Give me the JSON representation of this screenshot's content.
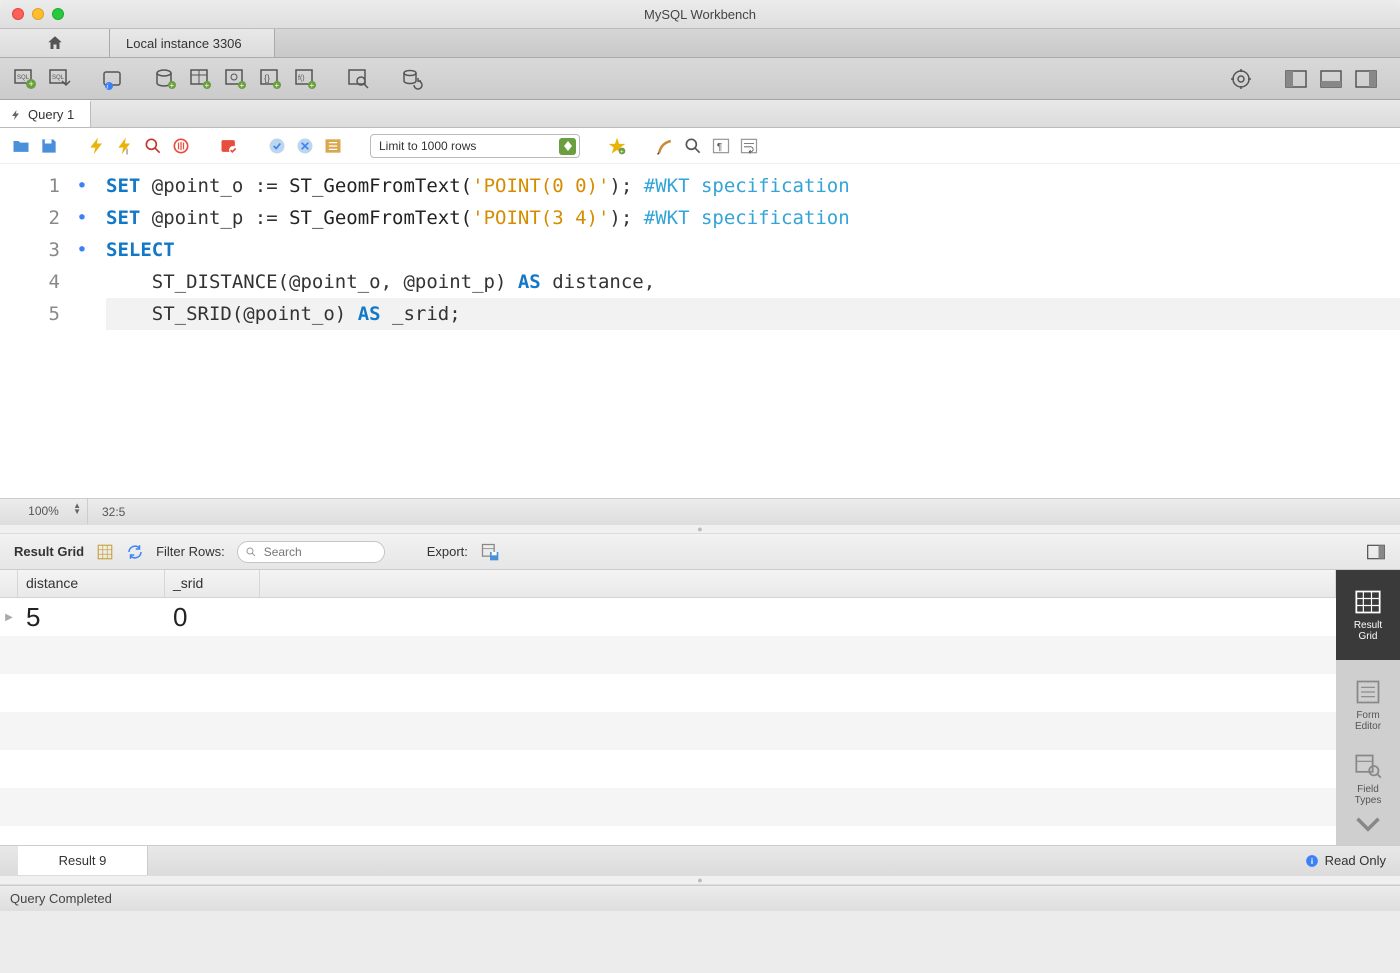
{
  "titlebar": {
    "title": "MySQL Workbench"
  },
  "connection_tab": "Local instance 3306",
  "query_tab": "Query 1",
  "editor": {
    "limit_label": "Limit to 1000 rows",
    "lines": [
      {
        "n": "1",
        "bullet": true
      },
      {
        "n": "2",
        "bullet": true
      },
      {
        "n": "3",
        "bullet": true
      },
      {
        "n": "4",
        "bullet": false
      },
      {
        "n": "5",
        "bullet": false
      }
    ],
    "tokens": {
      "l1": {
        "set": "SET",
        "var": "@point_o",
        "assign": ":=",
        "fn": "ST_GeomFromText(",
        "str": "'POINT(0 0)'",
        "close": ");",
        "comment": "#WKT specification"
      },
      "l2": {
        "set": "SET",
        "var": "@point_p",
        "assign": ":=",
        "fn": "ST_GeomFromText(",
        "str": "'POINT(3 4)'",
        "close": ");",
        "comment": "#WKT specification"
      },
      "l3": {
        "select": "SELECT"
      },
      "l4": {
        "indent": "    ",
        "fn1": "ST_DISTANCE(",
        "a1": "@point_o",
        "sep": ", ",
        "a2": "@point_p",
        "close1": ") ",
        "as": "AS",
        "alias": " distance,"
      },
      "l5": {
        "indent": "    ",
        "fn1": "ST_SRID(",
        "a1": "@point_o",
        "close1": ") ",
        "as": "AS",
        "alias": " _srid;"
      }
    },
    "zoom": "100%",
    "cursor": "32:5"
  },
  "result_bar": {
    "label": "Result Grid",
    "filter_label": "Filter Rows:",
    "filter_placeholder": "Search",
    "export_label": "Export:"
  },
  "grid": {
    "columns": [
      "distance",
      "_srid"
    ],
    "row": {
      "distance": "5",
      "_srid": "0"
    }
  },
  "side_tabs": {
    "result_grid": "Result\nGrid",
    "form_editor": "Form\nEditor",
    "field_types": "Field\nTypes"
  },
  "result_tab": "Result 9",
  "readonly": "Read Only",
  "footer": "Query Completed"
}
